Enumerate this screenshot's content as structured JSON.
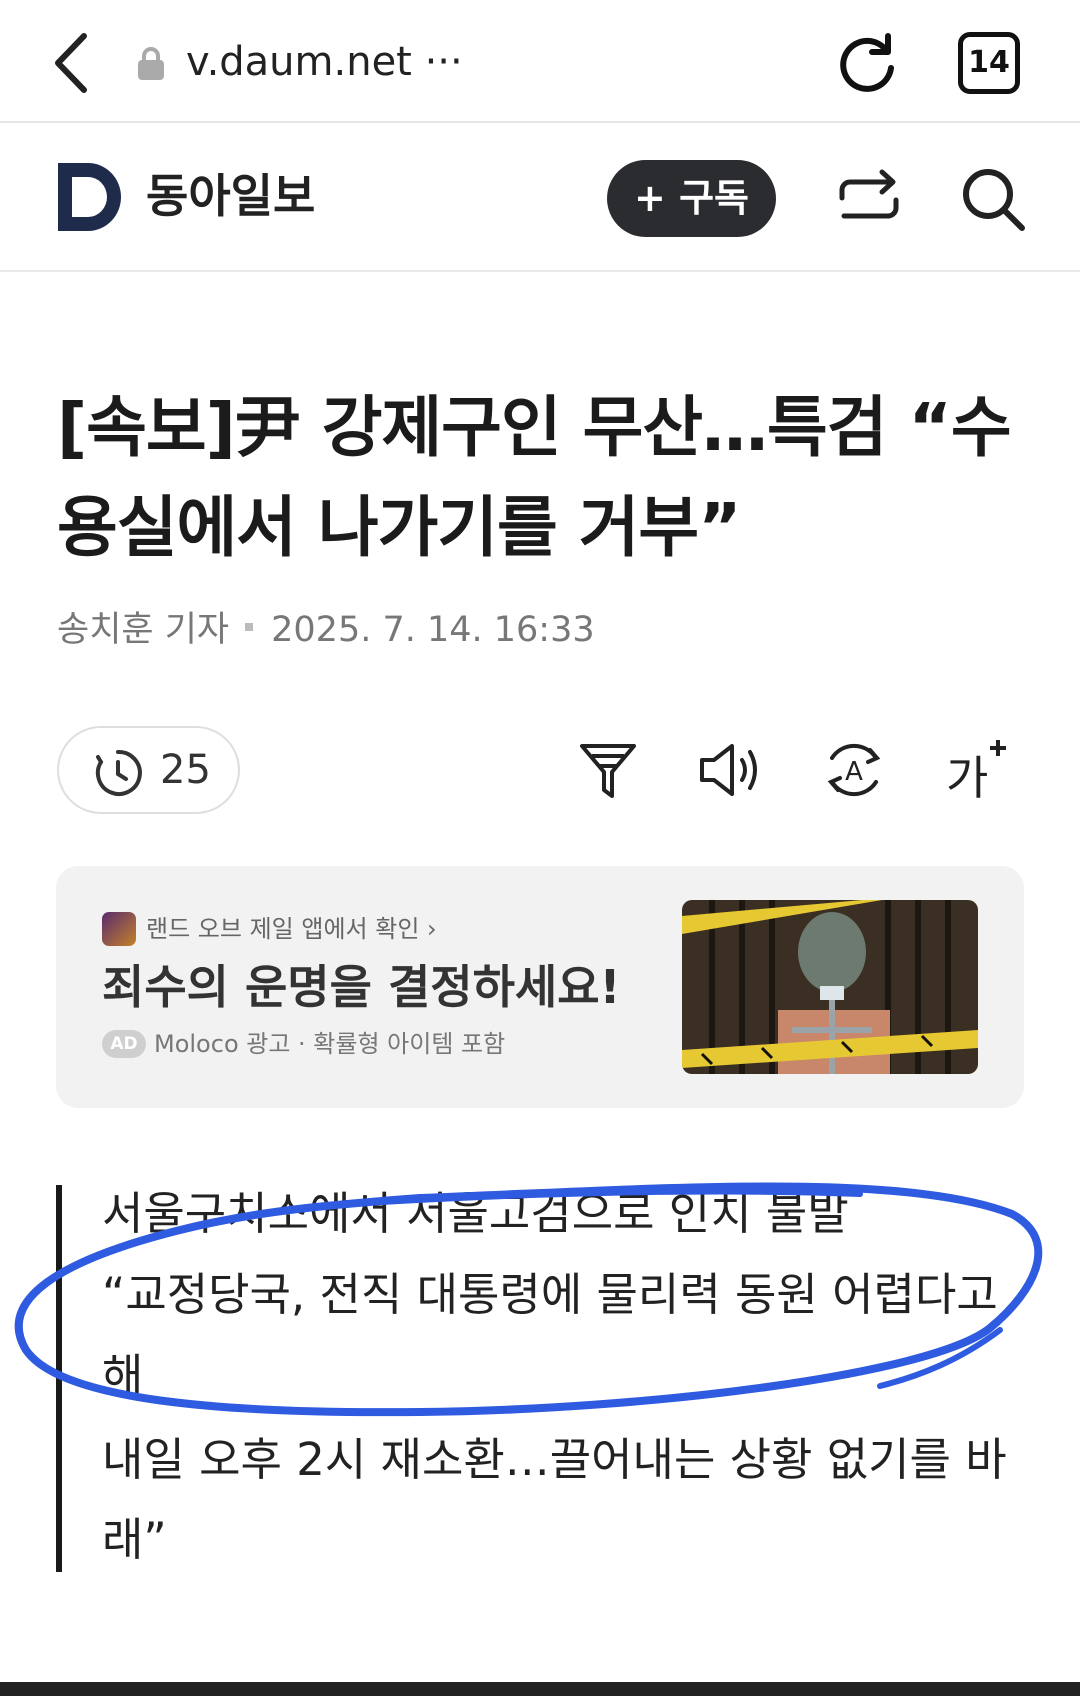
{
  "browser": {
    "url": "v.daum.net ···",
    "tab_count": "14",
    "icons": {
      "back": "back-arrow-icon",
      "lock": "lock-icon",
      "reload": "reload-icon"
    }
  },
  "publisher": {
    "name": "동아일보",
    "subscribe_label": "+ 구독",
    "icons": {
      "logo": "donga-logo-icon",
      "share": "share-icon",
      "search": "search-icon"
    }
  },
  "article": {
    "headline_line1": "[속보]尹 강제구인 무산…특검 “수",
    "headline_line2": "용실에서 나가기를 거부”",
    "author": "송치훈 기자",
    "datetime": "2025. 7. 14. 16:33"
  },
  "toolbar": {
    "read_count": "25",
    "icons": [
      "clock-icon",
      "filter-icon",
      "speaker-icon",
      "translate-icon",
      "font-size-icon"
    ],
    "font_size_glyph": "가"
  },
  "ad": {
    "source": "랜드 오브 제일 앱에서 확인 ›",
    "title": "죄수의 운명을 결정하세요!",
    "badge": "AD",
    "meta": "Moloco 광고 · 확률형 아이템 포함",
    "image_alt": "prisoner-image"
  },
  "summary": {
    "line1": "서울구치소에서 서울고검으로 인치 불발",
    "line2": "“교정당국, 전직 대통령에 물리력 동원 어렵다고",
    "line3": "해",
    "line4": "내일 오후 2시 재소환…끌어내는 상황 없기를 바",
    "line5": "래”"
  },
  "colors": {
    "annotation_stroke": "#2f5be0",
    "subscribe_bg": "#2a2c2f",
    "logo_navy": "#1f2b4a"
  }
}
